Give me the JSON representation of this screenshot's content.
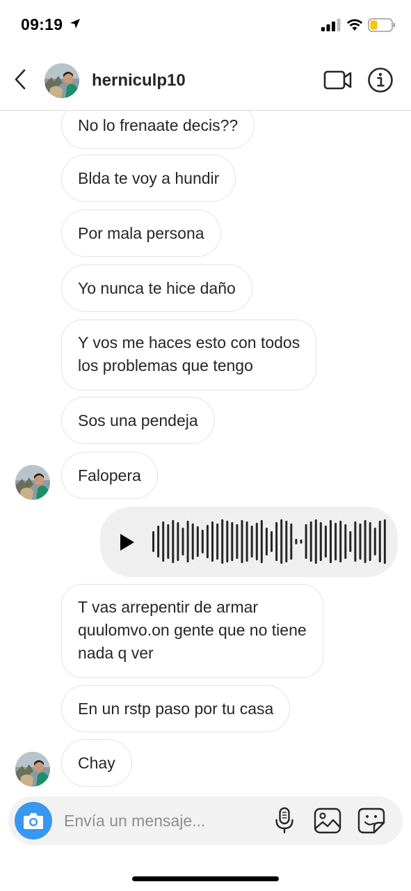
{
  "status_bar": {
    "time": "09:19",
    "battery_color": "#f5c70a"
  },
  "header": {
    "username": "herniculp10",
    "back_icon": "chevron-left-icon",
    "video_icon": "video-camera-icon",
    "info_icon": "info-icon"
  },
  "messages": [
    {
      "type": "text",
      "text": "No lo frenaate decis??"
    },
    {
      "type": "text",
      "text": "Blda te voy a hundir"
    },
    {
      "type": "text",
      "text": "Por mala persona"
    },
    {
      "type": "text",
      "text": "Yo nunca te hice daño"
    },
    {
      "type": "text",
      "text": "Y vos me haces esto con todos\nlos problemas que tengo"
    },
    {
      "type": "text",
      "text": "Sos una pendeja"
    },
    {
      "type": "text",
      "text": "Falopera"
    },
    {
      "type": "voice",
      "sender": "self"
    },
    {
      "type": "text",
      "text": "T vas arrepentir de armar\nquulomvo.on gente que no tiene\nnada q ver"
    },
    {
      "type": "text",
      "text": "En un rstp paso por tu casa"
    },
    {
      "type": "text",
      "text": "Chay"
    }
  ],
  "composer": {
    "placeholder": "Envía un mensaje...",
    "accent_color": "#3897f0"
  }
}
